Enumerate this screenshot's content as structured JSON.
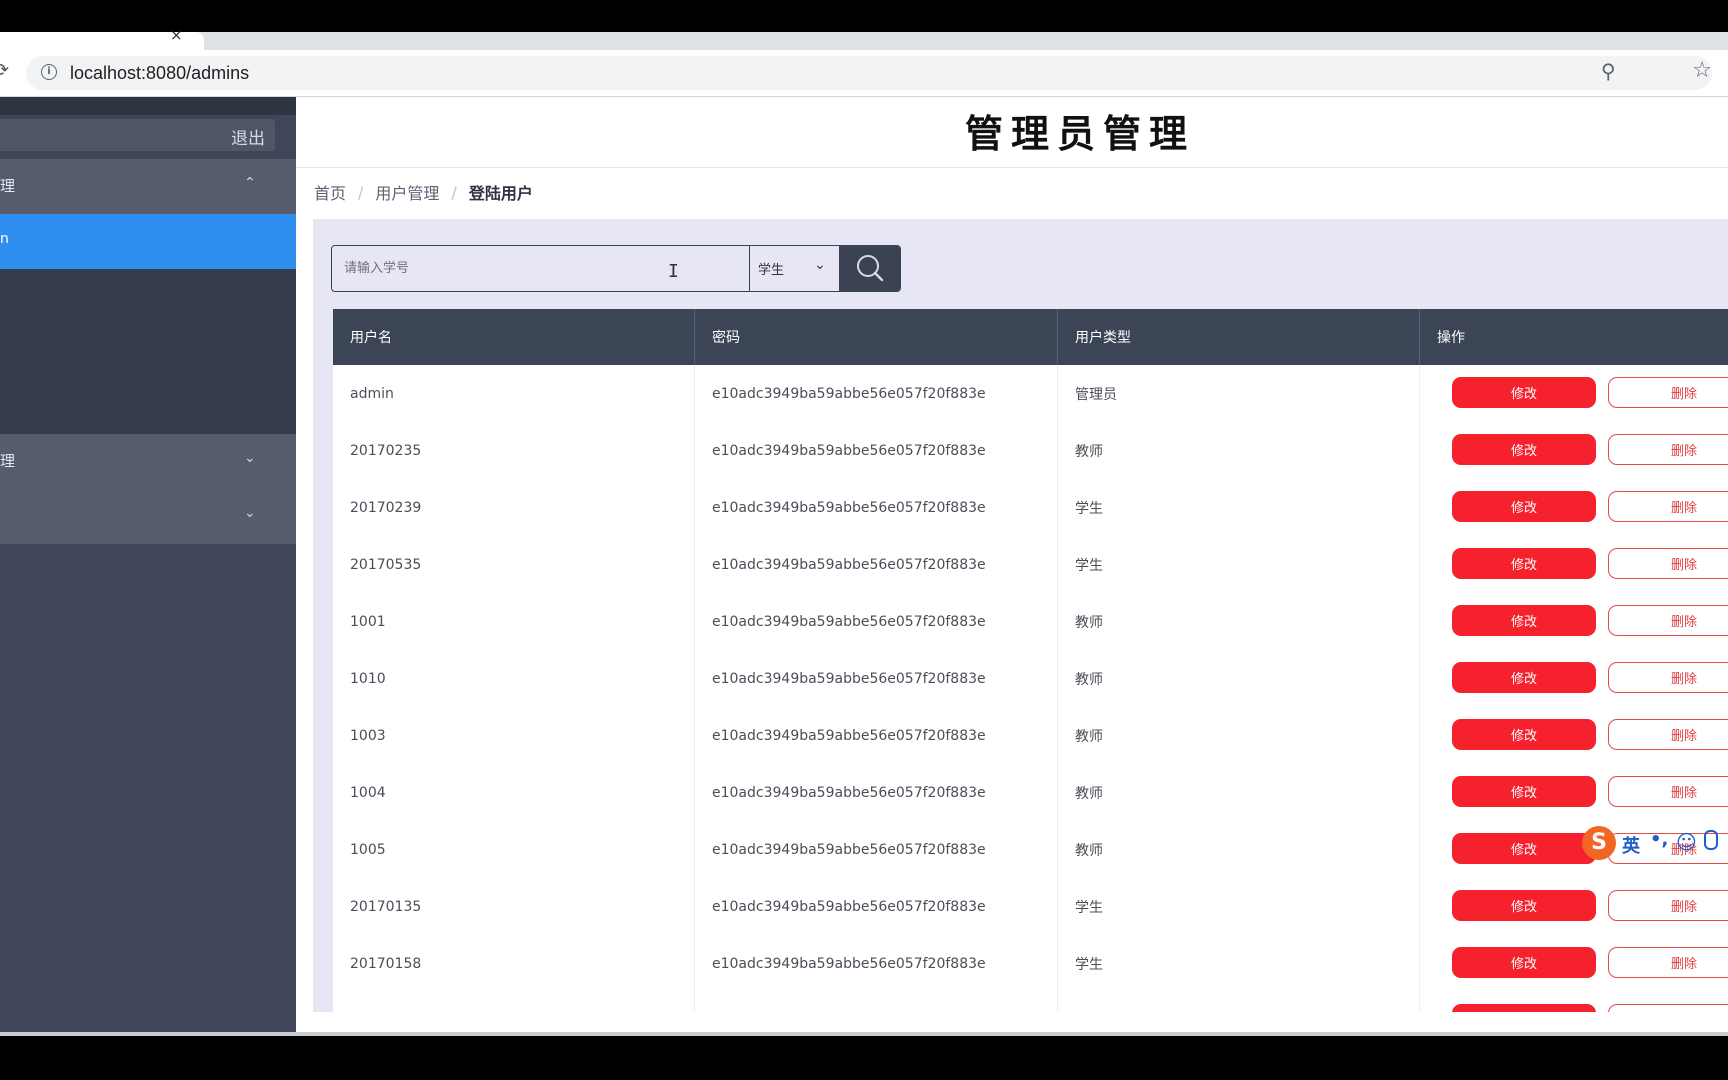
{
  "browser": {
    "url": "localhost:8080/admins",
    "tab_close": "×"
  },
  "sidebar": {
    "logout_label": "退出",
    "groups": [
      {
        "label": "理",
        "chevron": "⌃"
      },
      {
        "label": "理",
        "chevron": "⌄"
      },
      {
        "label": "",
        "chevron": "⌄"
      }
    ],
    "items": [
      {
        "label": "n"
      },
      {
        "label": ""
      },
      {
        "label": ""
      },
      {
        "label": ""
      }
    ]
  },
  "page": {
    "title": "管理员管理",
    "breadcrumb": [
      "首页",
      "用户管理",
      "登陆用户"
    ],
    "breadcrumb_sep": "/"
  },
  "search": {
    "placeholder": "请输入学号",
    "type_value": "学生"
  },
  "table": {
    "headers": [
      "用户名",
      "密码",
      "用户类型",
      "操作"
    ],
    "edit_label": "修改",
    "delete_label": "删除",
    "rows": [
      {
        "username": "admin",
        "password": "e10adc3949ba59abbe56e057f20f883e",
        "type": "管理员"
      },
      {
        "username": "20170235",
        "password": "e10adc3949ba59abbe56e057f20f883e",
        "type": "教师"
      },
      {
        "username": "20170239",
        "password": "e10adc3949ba59abbe56e057f20f883e",
        "type": "学生"
      },
      {
        "username": "20170535",
        "password": "e10adc3949ba59abbe56e057f20f883e",
        "type": "学生"
      },
      {
        "username": "1001",
        "password": "e10adc3949ba59abbe56e057f20f883e",
        "type": "教师"
      },
      {
        "username": "1010",
        "password": "e10adc3949ba59abbe56e057f20f883e",
        "type": "教师"
      },
      {
        "username": "1003",
        "password": "e10adc3949ba59abbe56e057f20f883e",
        "type": "教师"
      },
      {
        "username": "1004",
        "password": "e10adc3949ba59abbe56e057f20f883e",
        "type": "教师"
      },
      {
        "username": "1005",
        "password": "e10adc3949ba59abbe56e057f20f883e",
        "type": "教师"
      },
      {
        "username": "20170135",
        "password": "e10adc3949ba59abbe56e057f20f883e",
        "type": "学生"
      },
      {
        "username": "20170158",
        "password": "e10adc3949ba59abbe56e057f20f883e",
        "type": "学生"
      },
      {
        "username": "",
        "password": "",
        "type": ""
      }
    ]
  },
  "ime": {
    "logo": "S",
    "lang": "英",
    "punct": "•,"
  },
  "colors": {
    "sidebar_bg": "#3f4659",
    "active_item": "#2e8ef0",
    "table_header": "#3b4556",
    "danger": "#f5222d",
    "panel_bg": "#e6e6f4"
  }
}
